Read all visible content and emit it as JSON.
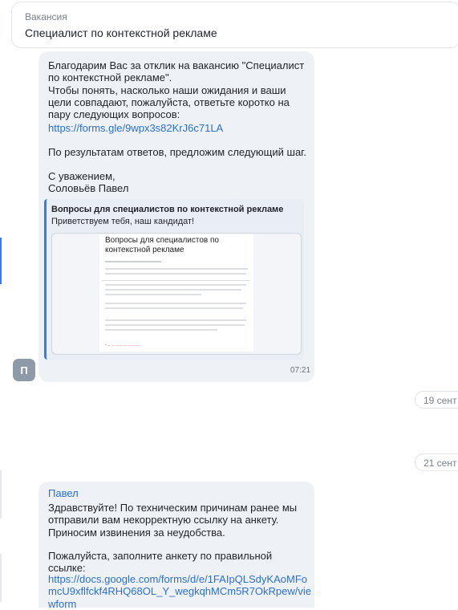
{
  "header": {
    "label": "Вакансия",
    "title": "Специалист по контекстной рекламе"
  },
  "message1": {
    "text": "Благодарим Вас за отклик на вакансию \"Специалист по контекстной рекламе\".\nЧтобы понять, насколько наши ожидания и ваши цели совпадают, пожалуйста, ответьте коротко на пару следующих вопросов:",
    "link": "https://forms.gle/9wpx3s82KrJ6c71LA",
    "text2": "По результатам ответов, предложим следующий шаг.\n\nС уважением,\nСоловьёв Павел",
    "preview": {
      "title": "Вопросы для специалистов по контекстной рекламе",
      "description": "Приветствуем тебя, наш кандидат!",
      "image_title": "Вопросы для специалистов по контекстной рекламе"
    },
    "avatar_letter": "П",
    "time": "07:21"
  },
  "date_separators": [
    "19 сент",
    "21 сент"
  ],
  "message2": {
    "sender": "Павел",
    "text": "Здравствуйте! По техническим причинам ранее мы отправили вам некорректную ссылку на анкету. Приносим извинения за неудобства.",
    "text2": "Пожалуйста, заполните анкету по правильной ссылке:",
    "link": "https://docs.google.com/forms/d/e/1FAIpQLSdyKAoMFomcU9xflfckf4RHQ68OL_Y_wegkqhMCm5R7OkRpew/viewform"
  },
  "colors": {
    "accent": "#2f7fe8",
    "link": "#2b6fd6",
    "bubble": "#eef2f6"
  }
}
